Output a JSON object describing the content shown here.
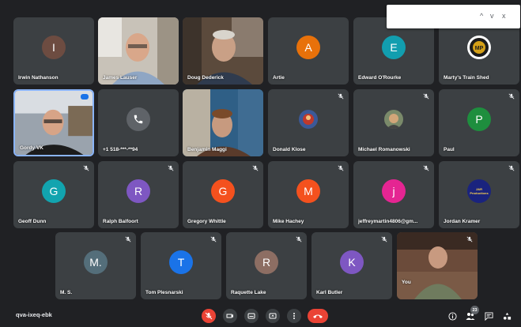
{
  "popup": {
    "up": "^",
    "down": "v",
    "close": "x"
  },
  "participants": [
    {
      "name": "Irwin Nathanson",
      "initial": "I",
      "color": "#6d4c41"
    },
    {
      "name": "James Lauser"
    },
    {
      "name": "Doug Dederick"
    },
    {
      "name": "Artie",
      "initial": "A",
      "color": "#e8710a"
    },
    {
      "name": "Edward O'Rourke",
      "initial": "E",
      "color": "#129eaf"
    },
    {
      "name": "Marty's Train Shed",
      "icon": "train-shed-logo"
    },
    {
      "name": "Gordy VK"
    },
    {
      "name": "+1 518-***-**94",
      "icon": "phone-icon"
    },
    {
      "name": "Benjamin Maggi"
    },
    {
      "name": "Donald Klose",
      "icon": "photo-avatar",
      "muted": true
    },
    {
      "name": "Michael Romanowski",
      "icon": "photo-avatar",
      "muted": true
    },
    {
      "name": "Paul",
      "initial": "P",
      "color": "#1e8e3e",
      "muted": true
    },
    {
      "name": "Geoff Dunn",
      "initial": "G",
      "color": "#12a4af",
      "muted": true
    },
    {
      "name": "Ralph Balfoort",
      "initial": "R",
      "color": "#7e57c2",
      "muted": true
    },
    {
      "name": "Gregory Whittle",
      "initial": "G",
      "color": "#f4511e",
      "muted": true
    },
    {
      "name": "Mike Hachey",
      "initial": "M",
      "color": "#f4511e",
      "muted": true
    },
    {
      "name": "jeffreymartin4806@gm...",
      "initial": "j",
      "color": "#e52592",
      "muted": true
    },
    {
      "name": "Jordan Kramer",
      "icon": "jkr-logo",
      "logo_text": "J&R\nProductions",
      "muted": true
    },
    {
      "name": "M. S.",
      "initial": "M.",
      "color": "#546e7a",
      "muted": true
    },
    {
      "name": "Tom Plesnarski",
      "initial": "T",
      "color": "#1a73e8",
      "muted": true
    },
    {
      "name": "Raquette Lake",
      "initial": "R",
      "color": "#8d6e63",
      "muted": true
    },
    {
      "name": "Karl Butler",
      "initial": "K",
      "color": "#7e57c2",
      "muted": true
    },
    {
      "name": "You",
      "muted": true
    }
  ],
  "bottom": {
    "meeting_code": "qva-ixeq-ebk",
    "participant_count": "23"
  }
}
